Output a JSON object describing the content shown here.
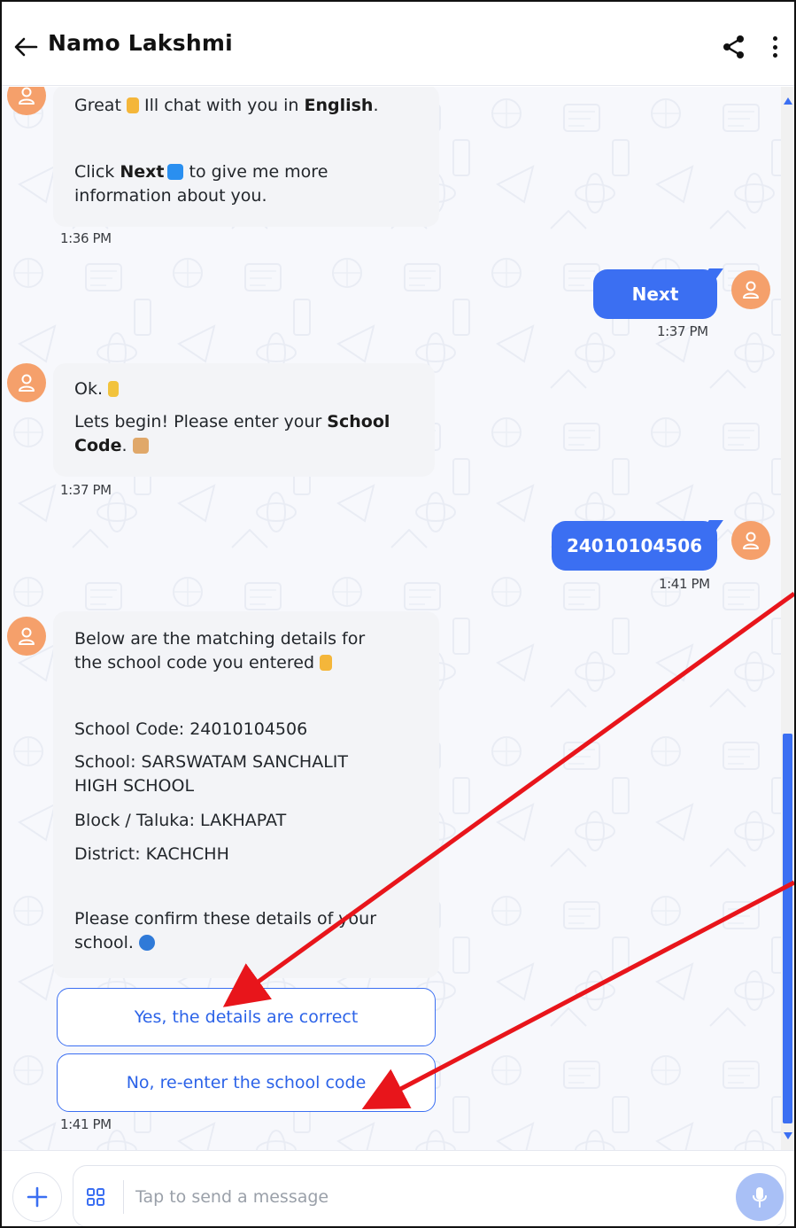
{
  "header": {
    "title": "Namo Lakshmi",
    "back_icon": "arrow-left-icon",
    "share_icon": "share-icon",
    "menu_icon": "more-vertical-icon"
  },
  "messages": {
    "m1": {
      "sender": "bot",
      "line1_pre": "Great ",
      "line1_mid": " Ill chat with you in ",
      "line1_bold": "English",
      "line1_end": ".",
      "line2_pre": "Click ",
      "line2_bold": "Next",
      "line2_post": " to give me more",
      "line3": "information about you.",
      "time": "1:36 PM"
    },
    "m2": {
      "sender": "user",
      "text": "Next",
      "time": "1:37 PM"
    },
    "m3": {
      "sender": "bot",
      "line1": "Ok. ",
      "line2_pre": "Lets begin! Please enter your ",
      "line2_bold": "School",
      "line3_bold": "Code",
      "line3_end": ". ",
      "time": "1:37 PM"
    },
    "m4": {
      "sender": "user",
      "text": "24010104506",
      "time": "1:41 PM"
    },
    "m5": {
      "sender": "bot",
      "intro1": "Below are the matching details for",
      "intro2": "the school code you entered ",
      "school_code": "School Code: 24010104506",
      "school1": "School: SARSWATAM SANCHALIT",
      "school2": "HIGH SCHOOL",
      "block": "Block / Taluka: LAKHAPAT",
      "district": "District: KACHCHH",
      "confirm1": "Please confirm these details of your",
      "confirm2": "school. ",
      "time": "1:41 PM",
      "options": [
        {
          "label": "Yes, the details are correct"
        },
        {
          "label": "No, re-enter the school code"
        }
      ]
    }
  },
  "composer": {
    "placeholder": "Tap to send a message",
    "plus_icon": "plus-icon",
    "grid_icon": "grid-icon",
    "mic_icon": "microphone-icon"
  },
  "colors": {
    "accent": "#3b6ff2",
    "avatar": "#f5a06b",
    "bot_bubble": "#f3f4f7",
    "annotation_arrow": "#e8151b"
  }
}
